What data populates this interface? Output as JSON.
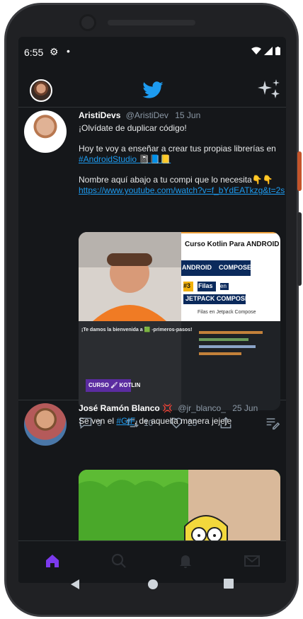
{
  "status_bar": {
    "time": "6:55"
  },
  "tweets": [
    {
      "name": "AristiDevs",
      "handle": "@AristiDev",
      "date": "15 Jun",
      "lines": [
        "¡Olvídate de duplicar código!",
        "",
        "Hoy te voy a enseñar a crear tus propias librerías en",
        "#AndroidStudio 📓📘📒",
        "",
        "Nombre aquí abajo a tu compi que lo necesita👇👇",
        "https://www.youtube.com/watch?v=f_bYdEATkzg&t=2s"
      ],
      "media_title": "Curso Kotlin Para ANDROID",
      "media_badges": [
        "ANDROID",
        "COMPOSE",
        "#3",
        "Filas",
        "en",
        "JETPACK COMPOSE"
      ],
      "media_subtitle": "Filas en Jetpack Compose",
      "media_doc_title": "¡Te damos la bienvenida a 🟩 -primeros-pasos!",
      "media_doc_badge": "CURSO 🖌 KOTLIN",
      "actions": {
        "replies": "3",
        "retweets": "10",
        "likes": "25"
      }
    },
    {
      "name": "José Ramón Blanco 💢",
      "handle": "@jr_blanco_",
      "date": "25 Jun",
      "text_before": "Se ven el ",
      "hashtag": "#GIF",
      "text_after": ", de aquella manera jejeje"
    }
  ],
  "icons": {
    "top_left": "avatar",
    "center": "twitter-bird-icon",
    "top_right": "sparkle-icon",
    "nav": [
      "home-icon",
      "search-icon",
      "notifications-icon",
      "messages-icon"
    ],
    "android": [
      "back-icon",
      "home-circle-icon",
      "recents-icon"
    ]
  },
  "colors": {
    "brand": "#1d9bf0",
    "active_nav": "#7c3aed"
  }
}
